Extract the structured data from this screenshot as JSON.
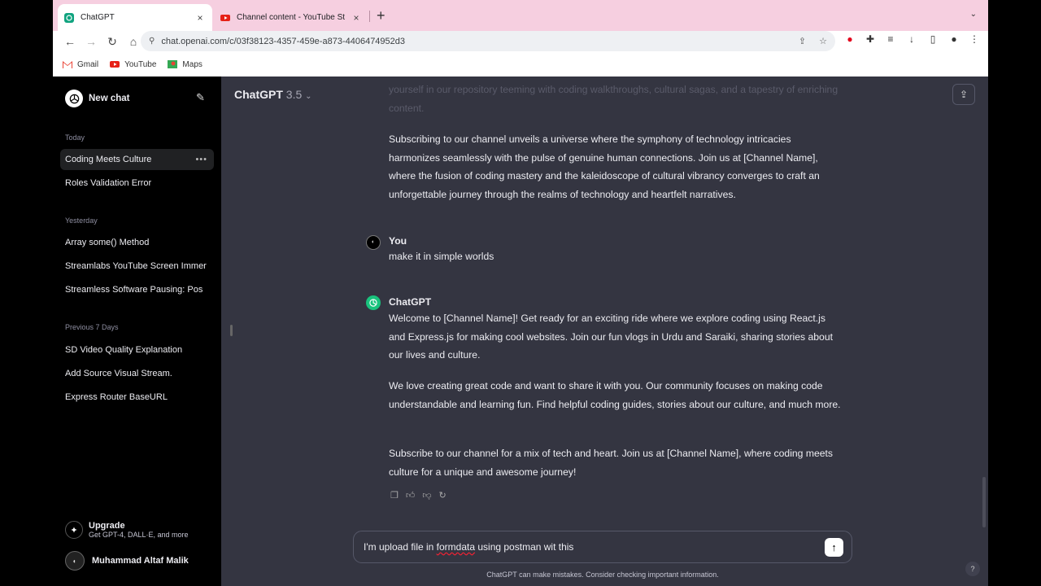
{
  "browser": {
    "tabs": [
      {
        "title": "ChatGPT",
        "close": "×"
      },
      {
        "title": "Channel content - YouTube St",
        "close": "×"
      }
    ],
    "new_tab": "+",
    "url": "chat.openai.com/c/03f38123-4357-459e-a873-4406474952d3",
    "bookmarks": [
      "Gmail",
      "YouTube",
      "Maps"
    ]
  },
  "sidebar": {
    "new_chat": "New chat",
    "sections": [
      {
        "label": "Today",
        "items": [
          "Coding Meets Culture",
          "Roles Validation Error"
        ]
      },
      {
        "label": "Yesterday",
        "items": [
          "Array some() Method",
          "Streamlabs YouTube Screen Immer",
          "Streamless Software Pausing: Pos"
        ]
      },
      {
        "label": "Previous 7 Days",
        "items": [
          "SD Video Quality Explanation",
          "Add Source Visual Stream.",
          "Express Router BaseURL"
        ]
      }
    ],
    "selected_dots": "•••",
    "upgrade": {
      "title": "Upgrade",
      "subtitle": "Get GPT-4, DALL·E, and more"
    },
    "user": {
      "name": "Muhammad Altaf Malik"
    }
  },
  "header": {
    "model": "ChatGPT",
    "version": "3.5"
  },
  "conversation": {
    "faded_text": "yourself in our repository teeming with coding walkthroughs, cultural sagas, and a tapestry of enriching content.",
    "prev_paragraph": "Subscribing to our channel unveils a universe where the symphony of technology intricacies harmonizes seamlessly with the pulse of genuine human connections. Join us at [Channel Name], where the fusion of coding mastery and the kaleidoscope of cultural vibrancy converges to craft an unforgettable journey through the realms of technology and heartfelt narratives.",
    "user_label": "You",
    "user_message": "make it in simple worlds",
    "assistant_label": "ChatGPT",
    "assistant_paragraphs": [
      "Welcome to [Channel Name]! Get ready for an exciting ride where we explore coding using React.js and Express.js for making cool websites. Join our fun vlogs in Urdu and Saraiki, sharing stories about our lives and culture.",
      "We love creating great code and want to share it with you. Our community focuses on making code understandable and learning fun. Find helpful coding guides, stories about our culture, and much more.",
      "Subscribe to our channel for a mix of tech and heart. Join us at [Channel Name], where coding meets culture for a unique and awesome journey!"
    ]
  },
  "composer": {
    "text_before": "I'm upload file in ",
    "text_misspelled": "formdata",
    "text_after": " using postman wit this"
  },
  "disclaimer": "ChatGPT can make mistakes. Consider checking important information.",
  "help": "?"
}
